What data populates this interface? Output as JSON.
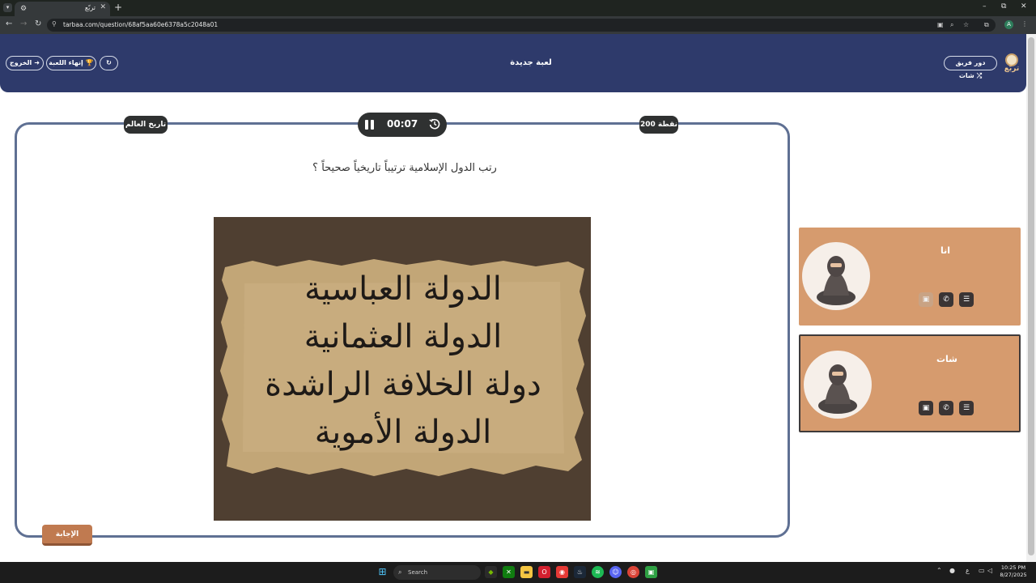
{
  "browser": {
    "tab_title": "تربّع",
    "url": "tarbaa.com/question/68af5aa60e6378a5c2048a01"
  },
  "header": {
    "title": "لعبة جديدة",
    "team_turn_label": "دور فريق شات",
    "end_game_label": "إنهاء اللعبة",
    "exit_label": "الخروج",
    "logo_text": "تربّع"
  },
  "question": {
    "category": "تاريخ العالم",
    "points": "200 نقطة",
    "timer": "00:07",
    "text": "رتب الدول الإسلامية ترتيباً تاريخياً صحيحاً ؟",
    "image_lines": [
      "الدولة العباسية",
      "الدولة العثمانية",
      "دولة الخلافة الراشدة",
      "الدولة الأموية"
    ],
    "answer_label": "الإجابة"
  },
  "players": [
    {
      "name": "انا"
    },
    {
      "name": "شات"
    }
  ],
  "taskbar": {
    "search_label": "Search",
    "time": "10:25 PM",
    "date": "8/27/2025",
    "lang": "ع"
  },
  "colors": {
    "header_bg": "#2e3a6b",
    "card_border": "#5f7093",
    "player_card": "#d69b6e",
    "answer_button": "#c07a50"
  }
}
